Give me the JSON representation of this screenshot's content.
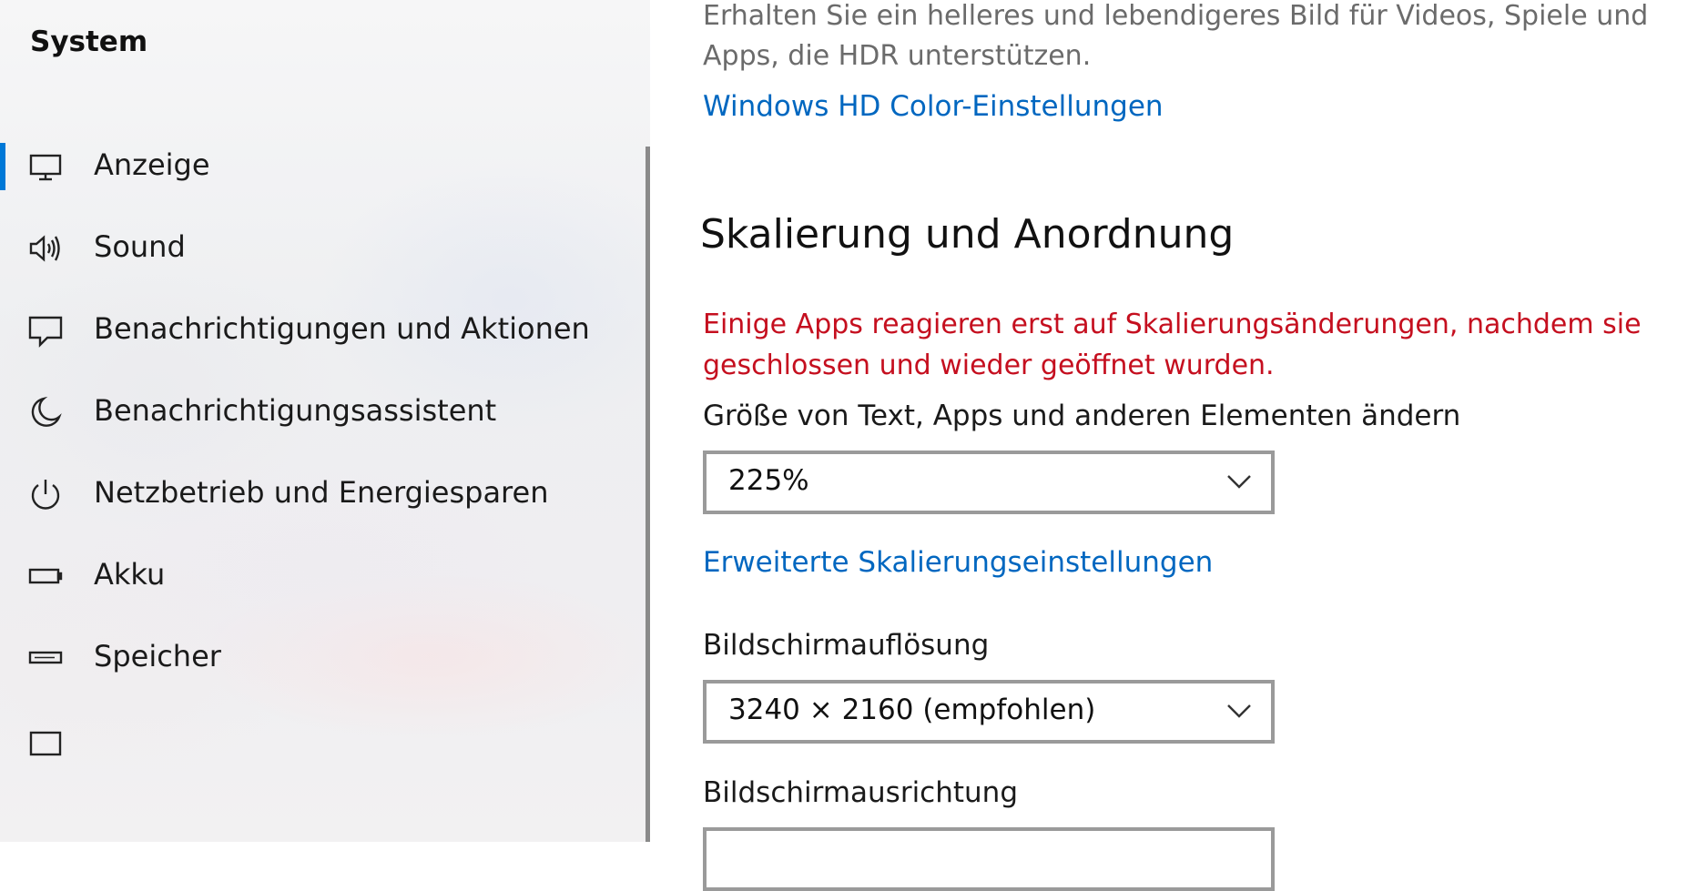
{
  "sidebar": {
    "title": "System",
    "items": [
      {
        "label": "Anzeige",
        "icon": "monitor-icon",
        "selected": true
      },
      {
        "label": "Sound",
        "icon": "speaker-icon",
        "selected": false
      },
      {
        "label": "Benachrichtigungen und Aktionen",
        "icon": "notification-icon",
        "selected": false
      },
      {
        "label": "Benachrichtigungsassistent",
        "icon": "moon-icon",
        "selected": false
      },
      {
        "label": "Netzbetrieb und Energiesparen",
        "icon": "power-icon",
        "selected": false
      },
      {
        "label": "Akku",
        "icon": "battery-icon",
        "selected": false
      },
      {
        "label": "Speicher",
        "icon": "storage-icon",
        "selected": false
      }
    ]
  },
  "main": {
    "hdr_description": "Erhalten Sie ein helleres und lebendigeres Bild für Videos, Spiele und Apps, die HDR unterstützen.",
    "hdr_link": "Windows HD Color-Einstellungen",
    "section_title": "Skalierung und Anordnung",
    "warning": "Einige Apps reagieren erst auf Skalierungsänderungen, nachdem sie geschlossen und wieder geöffnet wurden.",
    "scale_label": "Größe von Text, Apps und anderen Elementen ändern",
    "scale_value": "225%",
    "advanced_link": "Erweiterte Skalierungseinstellungen",
    "resolution_label": "Bildschirmauflösung",
    "resolution_value": "3240 × 2160 (empfohlen)",
    "orientation_label": "Bildschirmausrichtung"
  },
  "colors": {
    "accent": "#0078d7",
    "link": "#0067c0",
    "warning": "#c50f1f"
  }
}
